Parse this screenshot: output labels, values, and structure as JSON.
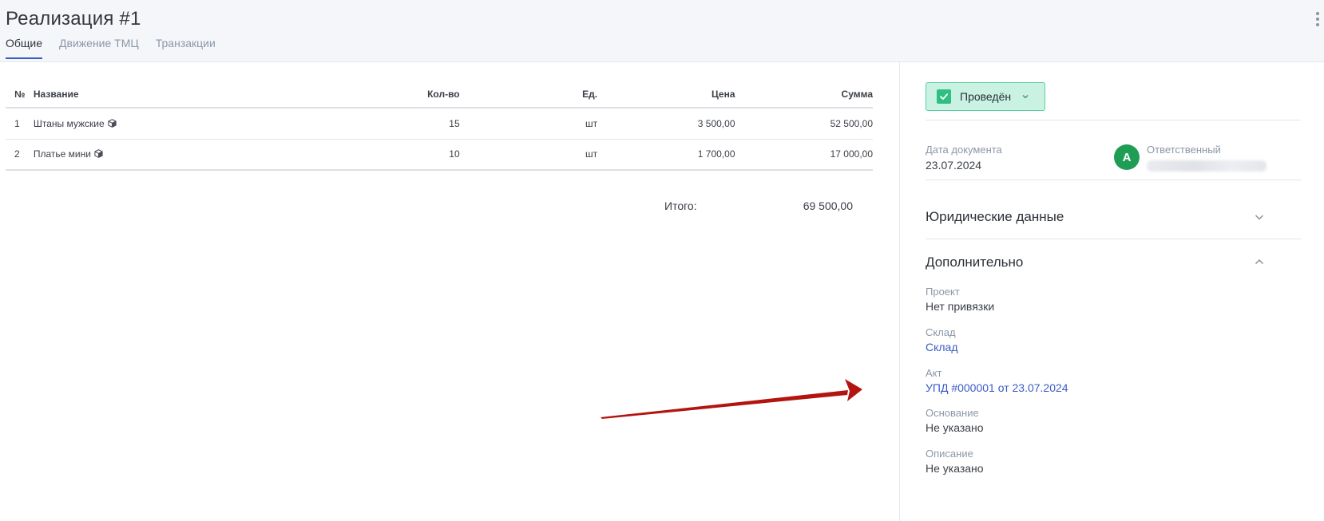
{
  "header": {
    "title": "Реализация #1",
    "tabs": [
      {
        "label": "Общие",
        "active": true
      },
      {
        "label": "Движение ТМЦ",
        "active": false
      },
      {
        "label": "Транзакции",
        "active": false
      }
    ]
  },
  "table": {
    "columns": [
      "№",
      "Название",
      "Кол-во",
      "Ед.",
      "Цена",
      "Сумма"
    ],
    "rows": [
      {
        "num": "1",
        "name": "Штаны мужские",
        "qty": "15",
        "unit": "шт",
        "price": "3 500,00",
        "sum": "52 500,00"
      },
      {
        "num": "2",
        "name": "Платье мини",
        "qty": "10",
        "unit": "шт",
        "price": "1 700,00",
        "sum": "17 000,00"
      }
    ],
    "total_label": "Итого:",
    "total_value": "69 500,00"
  },
  "sidebar": {
    "status": "Проведён",
    "doc_date_label": "Дата документа",
    "doc_date_value": "23.07.2024",
    "avatar_letter": "А",
    "responsible_label": "Ответственный",
    "legal_section": "Юридические данные",
    "extra_section": "Дополнительно",
    "fields": [
      {
        "label": "Проект",
        "value": "Нет привязки"
      },
      {
        "label": "Склад",
        "value": "Склад"
      },
      {
        "label": "Акт",
        "value": "УПД #000001 от 23.07.2024"
      },
      {
        "label": "Основание",
        "value": "Не указано"
      },
      {
        "label": "Описание",
        "value": "Не указано"
      }
    ]
  },
  "colors": {
    "accent": "#3b5bc6",
    "status_bg": "#c9f2e3",
    "status_border": "#59cfa2",
    "avatar": "#1f9d55",
    "annotation_arrow": "#b3140f"
  },
  "icons": {
    "kebab": "more-vertical-icon",
    "item": "box-icon",
    "status_check": "check-icon",
    "status_dropdown": "chevron-down-icon",
    "legal_toggle": "chevron-down-icon",
    "extra_toggle": "chevron-up-icon"
  }
}
